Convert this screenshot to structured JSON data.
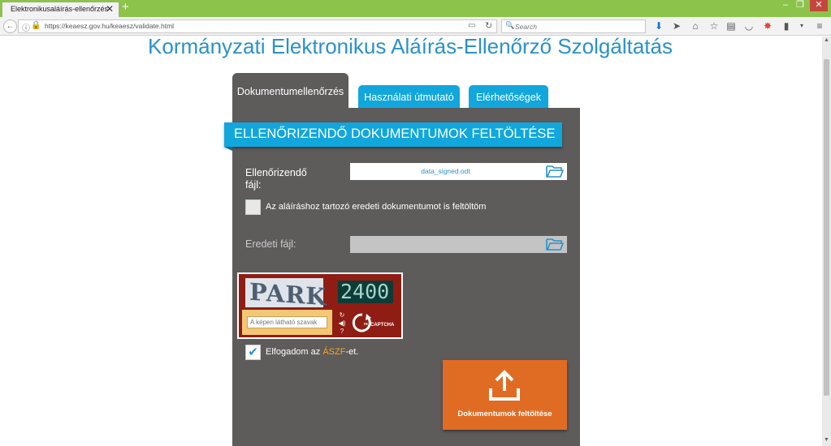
{
  "browser": {
    "tab_title": "Elektronikusaláírás-ellenőrzés",
    "url": "https://keaesz.gov.hu/keaesz/validate.html",
    "search_placeholder": "Search"
  },
  "page": {
    "title": "Kormányzati Elektronikus Aláírás-Ellenőrző Szolgáltatás"
  },
  "tabs": [
    {
      "label": "Dokumentumellenőrzés",
      "active": true
    },
    {
      "label": "Használati útmutató",
      "active": false
    },
    {
      "label": "Elérhetőségek",
      "active": false
    }
  ],
  "form": {
    "header": "ELLENŐRIZENDŐ DOKUMENTUMOK FELTÖLTÉSE",
    "file_label": "Ellenőrizendő fájl:",
    "file_value": "data_signed.odt",
    "orig_checkbox_label": "Az aláíráshoz tartozó eredeti dokumentumot is feltöltöm",
    "orig_file_label": "Eredeti fájl:",
    "captcha": {
      "word1": "PARK",
      "word2": "2400",
      "placeholder": "A képen látható szavak",
      "logo_text": "CAPTCHA"
    },
    "aszf_prefix": "Elfogadom az ",
    "aszf_link": "ÁSZF",
    "aszf_suffix": "-et.",
    "aszf_checked": true,
    "upload_button": "Dokumentumok feltöltése"
  },
  "colors": {
    "brand_blue": "#11a7dd",
    "title_blue": "#2a92c8",
    "panel_gray": "#5e5b5b",
    "upload_orange": "#e06c24",
    "captcha_red": "#8f1d13",
    "browser_green": "#8cc34b"
  }
}
